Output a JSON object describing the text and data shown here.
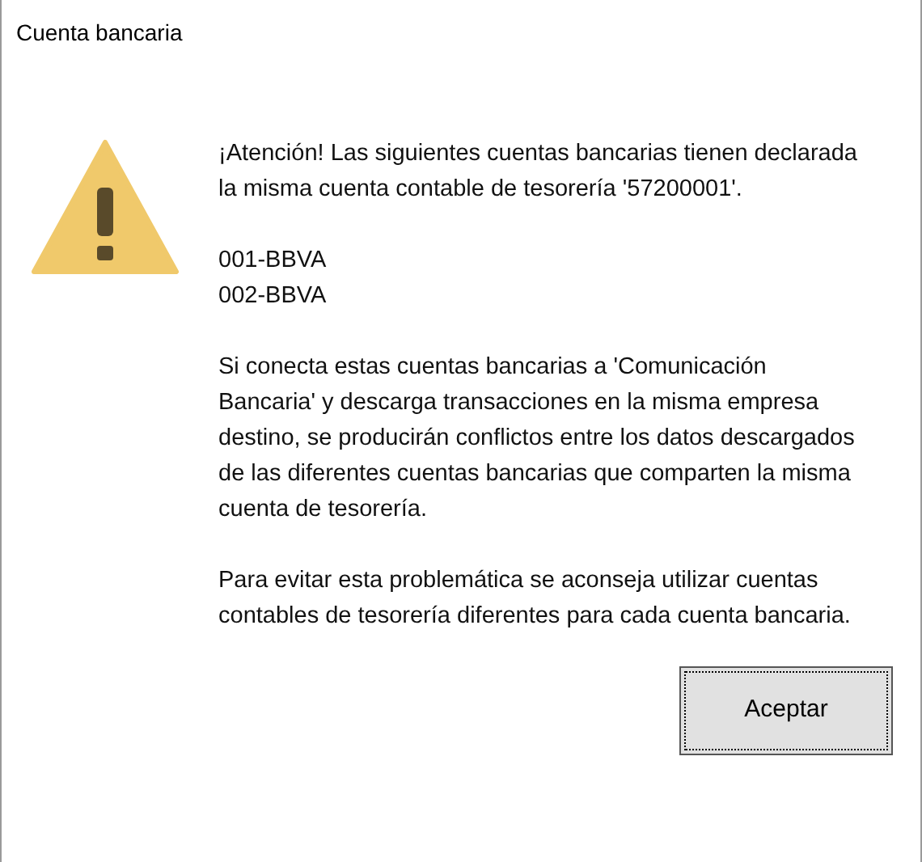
{
  "window": {
    "title": "Cuenta bancaria"
  },
  "message": {
    "paragraphs": [
      {
        "lines": [
          "¡Atención! Las siguientes cuentas bancarias tienen declarada la misma cuenta contable de tesorería '57200001'."
        ]
      },
      {
        "lines": [
          "001-BBVA",
          "002-BBVA"
        ]
      },
      {
        "lines": [
          "Si conecta estas cuentas bancarias a 'Comunicación Bancaria' y descarga transacciones en la misma empresa destino, se producirán conflictos entre los datos descargados de las diferentes cuentas bancarias que comparten la misma cuenta de tesorería."
        ]
      },
      {
        "lines": [
          "Para evitar esta problemática se aconseja utilizar cuentas contables de tesorería diferentes para cada cuenta bancaria."
        ]
      }
    ]
  },
  "buttons": [
    {
      "label": "Aceptar",
      "focused": true
    }
  ]
}
